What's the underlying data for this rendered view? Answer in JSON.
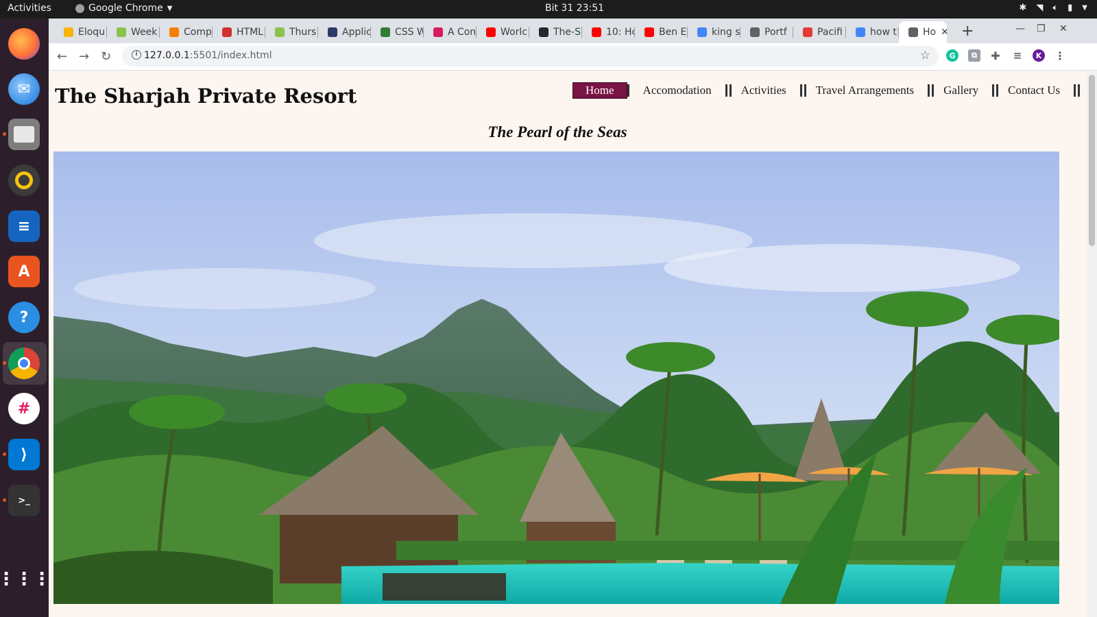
{
  "system": {
    "activities_label": "Activities",
    "app_name": "Google Chrome",
    "clock": "Bit 31  23:51"
  },
  "browser": {
    "tabs": [
      {
        "label": "Eloqu",
        "favicon_color": "#f4b400"
      },
      {
        "label": "Week",
        "favicon_color": "#8bc34a"
      },
      {
        "label": "Comp",
        "favicon_color": "#f57d00"
      },
      {
        "label": "HTML",
        "favicon_color": "#d32f2f"
      },
      {
        "label": "Thurs",
        "favicon_color": "#8bc34a"
      },
      {
        "label": "Applic",
        "favicon_color": "#2b3a67"
      },
      {
        "label": "CSS W",
        "favicon_color": "#2e7d32"
      },
      {
        "label": "A Con",
        "favicon_color": "#d81b60"
      },
      {
        "label": "Worlc",
        "favicon_color": "#ff0000"
      },
      {
        "label": "The-S",
        "favicon_color": "#24292e"
      },
      {
        "label": "10: Hc",
        "favicon_color": "#ff0000"
      },
      {
        "label": "Ben E",
        "favicon_color": "#ff0000"
      },
      {
        "label": "king s",
        "favicon_color": "#4285f4"
      },
      {
        "label": "Portf",
        "favicon_color": "#5f6368"
      },
      {
        "label": "Pacifi",
        "favicon_color": "#e53935"
      },
      {
        "label": "how t",
        "favicon_color": "#4285f4"
      },
      {
        "label": "Ho",
        "favicon_color": "#5f6368",
        "active": true
      }
    ],
    "url_host": "127.0.0.1",
    "url_rest": ":5501/index.html",
    "profile_initial": "K"
  },
  "site": {
    "title": "The Sharjah Private Resort",
    "tagline": "The Pearl of the Seas",
    "nav": [
      "Home",
      "Accomodation",
      "Activities",
      "Travel Arrangements",
      "Gallery",
      "Contact Us"
    ],
    "active_nav": "Home"
  }
}
